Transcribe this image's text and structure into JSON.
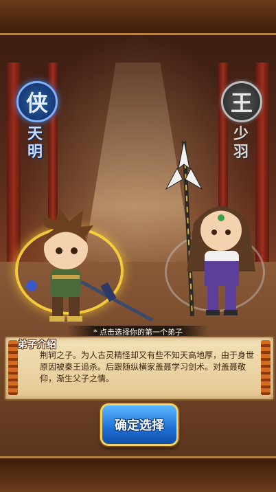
{
  "heroes": [
    {
      "badge": "侠",
      "name": "天明",
      "selected": true,
      "theme_color": "#2d5fa8"
    },
    {
      "badge": "王",
      "name": "少羽",
      "selected": false,
      "theme_color": "#5a5a5a"
    }
  ],
  "hint": "* 点击选择你的第一个弟子",
  "intro": {
    "title": "弟子介绍",
    "text": "荆轲之子。为人古灵精怪却又有些不知天高地厚，由于身世原因被秦王追杀。后跟随纵横家盖聂学习剑术。对盖聂敬仰，渐生父子之情。"
  },
  "confirm_button": "确定选择",
  "colors": {
    "accent_gold": "#f2d36b",
    "button_blue": "#1f6fd6",
    "parchment": "#f3e1b8"
  }
}
